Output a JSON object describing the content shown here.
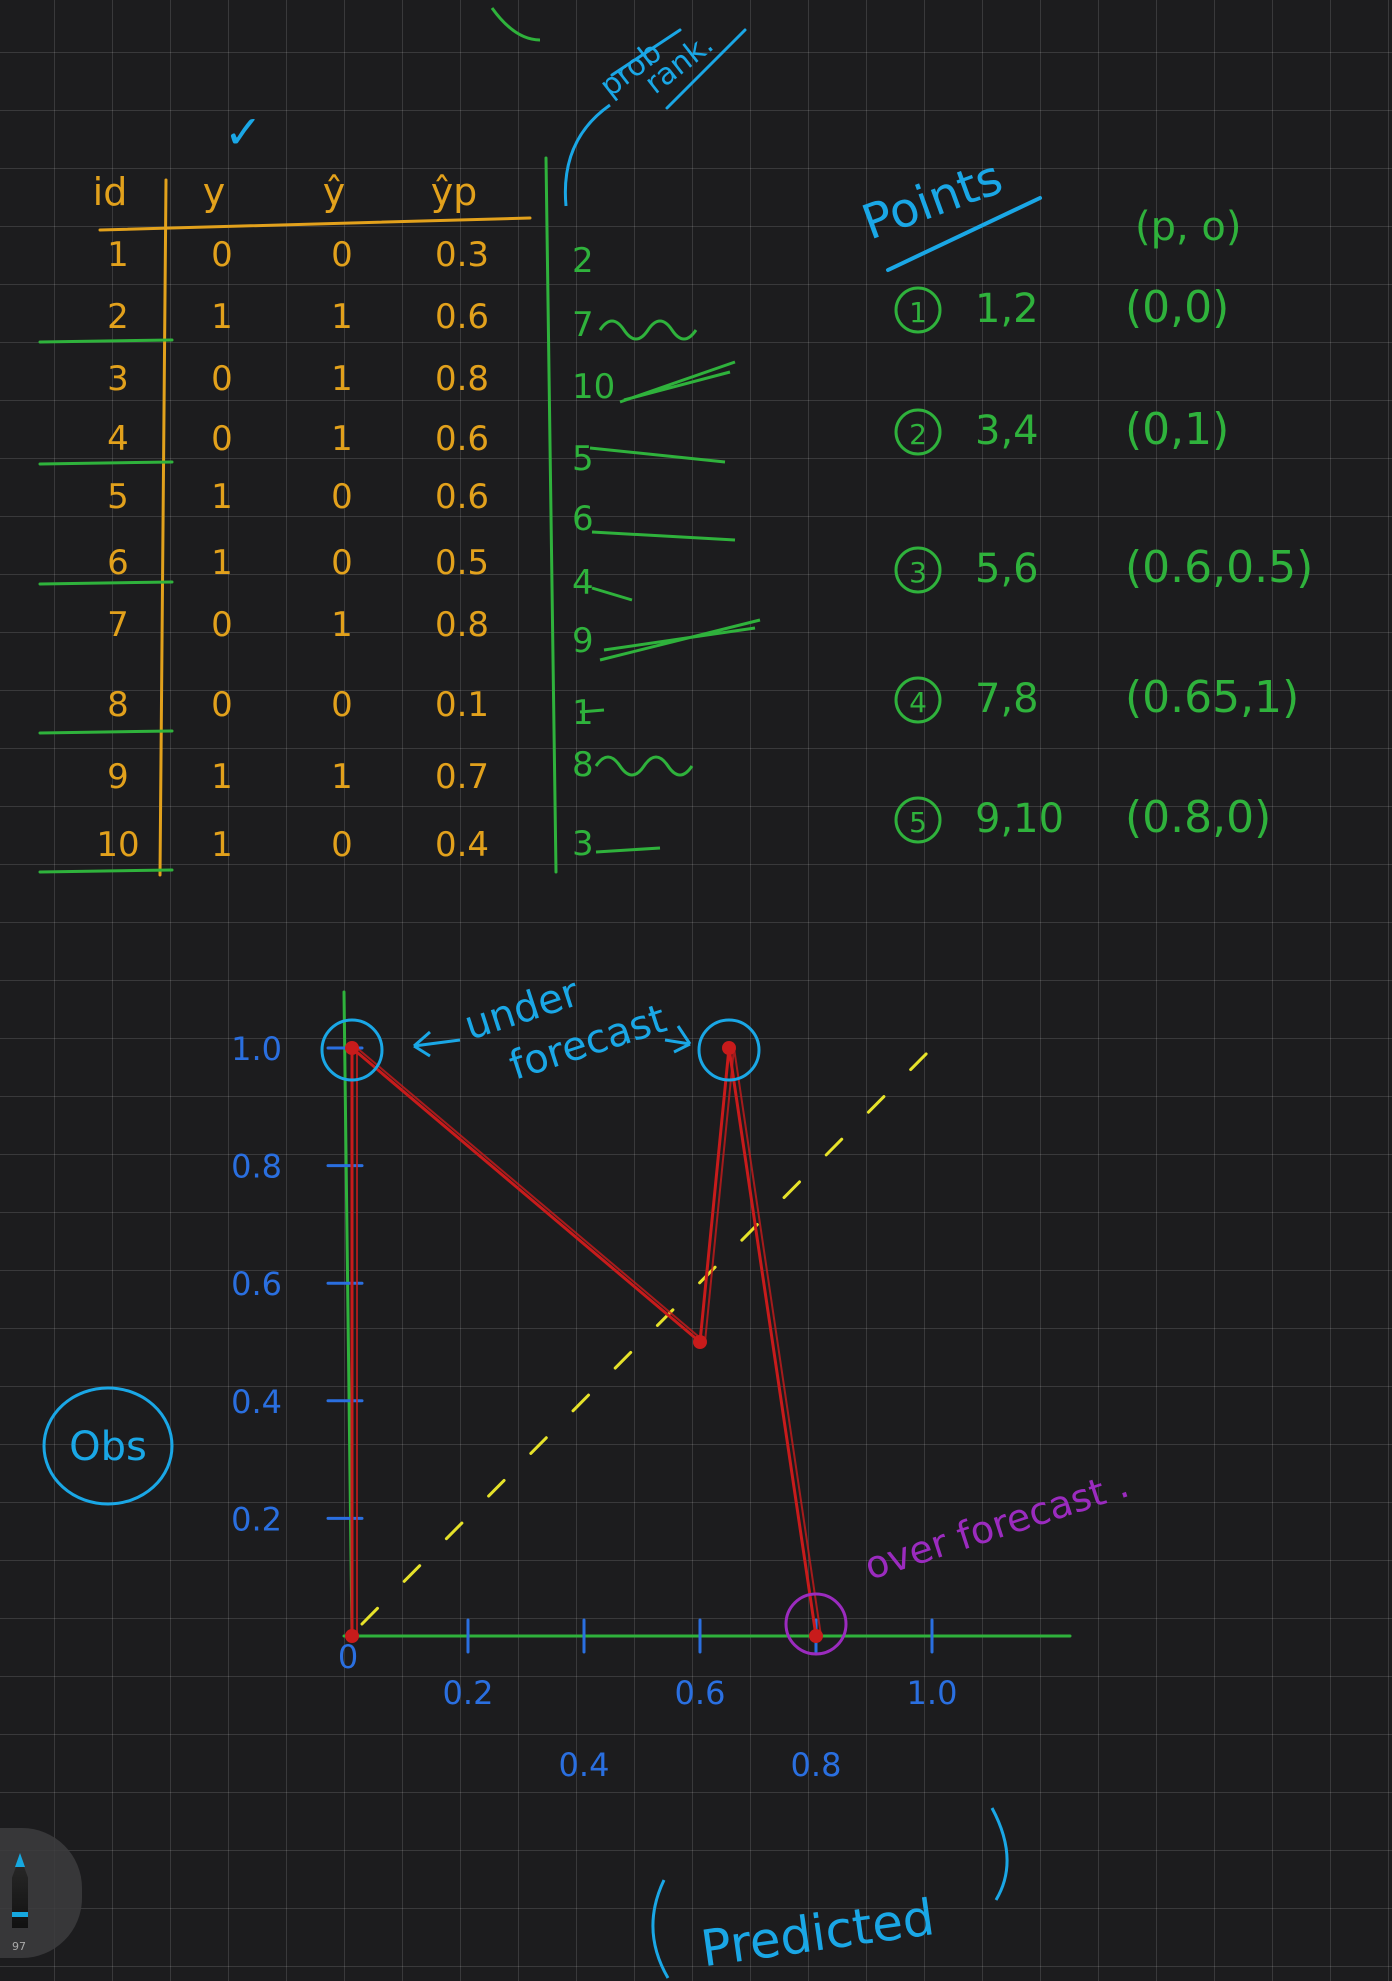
{
  "colors": {
    "orange": "#e2a11c",
    "green": "#2fb23c",
    "blue": "#1aa7e6",
    "blue_axis": "#2a6fe0",
    "red": "#c81b1b",
    "yellow": "#e6e22a",
    "purple": "#9b2bbf"
  },
  "top_note": {
    "line1": "prob",
    "line2": "rank."
  },
  "table": {
    "headers": [
      "id",
      "y",
      "ŷ",
      "ŷp"
    ],
    "header_check": "✓",
    "rows": [
      {
        "id": "1",
        "y": "0",
        "yhat": "0",
        "yp": "0.3"
      },
      {
        "id": "2",
        "y": "1",
        "yhat": "1",
        "yp": "0.6"
      },
      {
        "id": "3",
        "y": "0",
        "yhat": "1",
        "yp": "0.8"
      },
      {
        "id": "4",
        "y": "0",
        "yhat": "1",
        "yp": "0.6"
      },
      {
        "id": "5",
        "y": "1",
        "yhat": "0",
        "yp": "0.6"
      },
      {
        "id": "6",
        "y": "1",
        "yhat": "0",
        "yp": "0.5"
      },
      {
        "id": "7",
        "y": "0",
        "yhat": "1",
        "yp": "0.8"
      },
      {
        "id": "8",
        "y": "0",
        "yhat": "0",
        "yp": "0.1"
      },
      {
        "id": "9",
        "y": "1",
        "yhat": "1",
        "yp": "0.7"
      },
      {
        "id": "10",
        "y": "1",
        "yhat": "0",
        "yp": "0.4"
      }
    ],
    "ranks": [
      "2",
      "7",
      "10",
      "5",
      "6",
      "4",
      "9",
      "1",
      "8",
      "3"
    ]
  },
  "points": {
    "title": "Points",
    "header": "(p, o)",
    "items": [
      {
        "num": "1",
        "ids": "1,2",
        "coord": "(0,0)"
      },
      {
        "num": "2",
        "ids": "3,4",
        "coord": "(0,1)"
      },
      {
        "num": "3",
        "ids": "5,6",
        "coord": "(0.6,0.5)"
      },
      {
        "num": "4",
        "ids": "7,8",
        "coord": "(0.65,1)"
      },
      {
        "num": "5",
        "ids": "9,10",
        "coord": "(0.8,0)"
      }
    ]
  },
  "chart_data": {
    "type": "line",
    "xlabel": "Predicted",
    "ylabel": "Obs",
    "x_ticks": [
      "0",
      "0.2",
      "0.4",
      "0.6",
      "0.8",
      "1.0"
    ],
    "y_ticks": [
      "0.2",
      "0.4",
      "0.6",
      "0.8",
      "1.0"
    ],
    "xlim": [
      0,
      1
    ],
    "ylim": [
      0,
      1
    ],
    "series": [
      {
        "points": [
          [
            0,
            0
          ],
          [
            0,
            1
          ],
          [
            0.6,
            0.5
          ],
          [
            0.65,
            1
          ],
          [
            0.8,
            0
          ]
        ]
      },
      {
        "style": "dashed",
        "points": [
          [
            0,
            0
          ],
          [
            1,
            1
          ]
        ]
      }
    ],
    "annotations": [
      {
        "text": "under forecast",
        "targets": [
          [
            0,
            1
          ],
          [
            0.65,
            1
          ]
        ]
      },
      {
        "text": "over forecast .",
        "targets": [
          [
            0.8,
            0
          ]
        ]
      }
    ]
  },
  "pen": {
    "size": "97"
  }
}
